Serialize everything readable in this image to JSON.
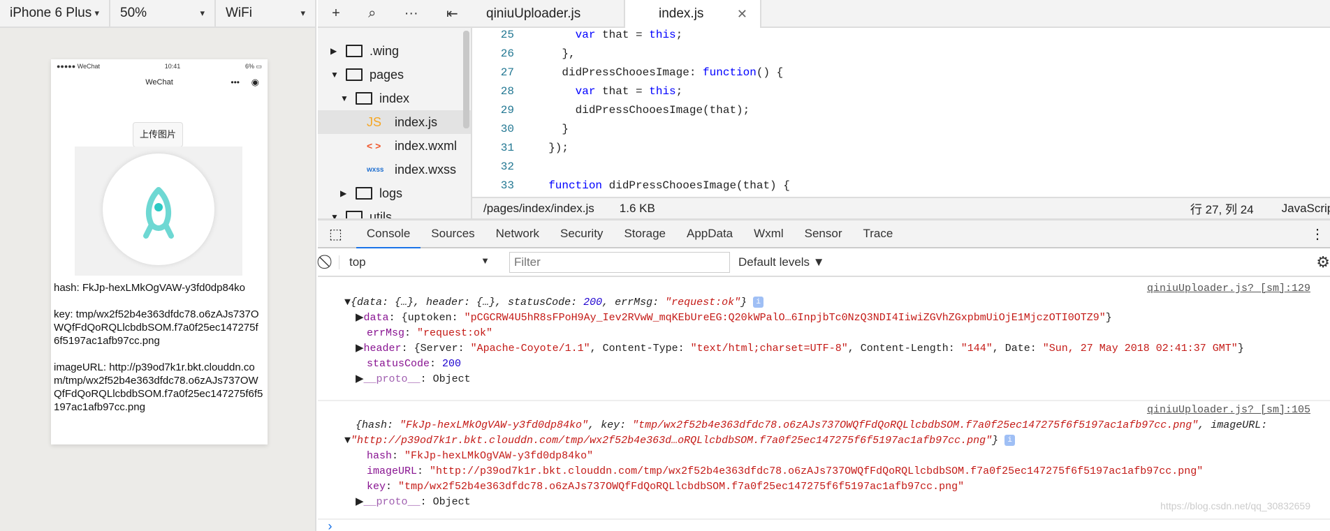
{
  "simulator": {
    "device": "iPhone 6 Plus",
    "zoom": "50%",
    "network": "WiFi"
  },
  "phone": {
    "signal": "●●●●● WeChat",
    "time": "10:41",
    "battery": "6%",
    "nav_title": "WeChat",
    "upload_button": "上传图片",
    "hash_text": "hash: FkJp-hexLMkOgVAW-y3fd0dp84ko",
    "key_text": "key: tmp/wx2f52b4e363dfdc78.o6zAJs737OWQfFdQoRQLlcbdbSOM.f7a0f25ec147275f6f5197ac1afb97cc.png",
    "url_text": "imageURL: http://p39od7k1r.bkt.clouddn.com/tmp/wx2f52b4e363dfdc78.o6zAJs737OWQfFdQoRQLlcbdbSOM.f7a0f25ec147275f6f5197ac1afb97cc.png"
  },
  "tree": [
    {
      "label": ".wing"
    },
    {
      "label": "pages"
    },
    {
      "label": "index"
    },
    {
      "label": "index.js",
      "badge": "JS"
    },
    {
      "label": "index.wxml",
      "badge": "< >"
    },
    {
      "label": "index.wxss",
      "badge": "wxss"
    },
    {
      "label": "logs"
    },
    {
      "label": "utils"
    }
  ],
  "editor": {
    "tabs": [
      "qiniuUploader.js",
      "index.js"
    ],
    "lines": [
      {
        "n": "25",
        "t": "      var that = this;"
      },
      {
        "n": "26",
        "t": "    },"
      },
      {
        "n": "27",
        "t": "    didPressChooesImage: function() {"
      },
      {
        "n": "28",
        "t": "      var that = this;"
      },
      {
        "n": "29",
        "t": "      didPressChooesImage(that);"
      },
      {
        "n": "30",
        "t": "    }"
      },
      {
        "n": "31",
        "t": "  });"
      },
      {
        "n": "32",
        "t": ""
      },
      {
        "n": "33",
        "t": "  function didPressChooesImage(that) {"
      }
    ],
    "path": "/pages/index/index.js",
    "size": "1.6 KB",
    "cursor": "行 27, 列 24",
    "language": "JavaScript"
  },
  "devtools": {
    "tabs": [
      "Console",
      "Sources",
      "Network",
      "Security",
      "Storage",
      "AppData",
      "Wxml",
      "Sensor",
      "Trace"
    ],
    "context": "top",
    "filter_placeholder": "Filter",
    "levels": "Default levels ▼"
  },
  "console": {
    "m1": {
      "src": "qiniuUploader.js? [sm]:129",
      "l1a": "{data: {…}, header: {…}, statusCode: ",
      "l1b": "200",
      "l1c": ", errMsg: ",
      "l1d": "\"request:ok\"",
      "l1e": "}",
      "data_k": "data",
      "data_v": ": {uptoken: ",
      "data_s": "\"pCGCRW4U5hR8sFPoH9Ay_Iev2RVwW_mqKEbUreEG:Q20kWPalO…6InpjbTc0NzQ3NDI4IiwiZGVhZGxpbmUiOjE1MjczOTI0OTZ9\"",
      "data_e": "}",
      "err_k": "errMsg",
      "err_v": "\"request:ok\"",
      "hdr_k": "header",
      "hdr_1": ": {Server: ",
      "hdr_2": "\"Apache-Coyote/1.1\"",
      "hdr_3": ", Content-Type: ",
      "hdr_4": "\"text/html;charset=UTF-8\"",
      "hdr_5": ", Content-Length: ",
      "hdr_6": "\"144\"",
      "hdr_7": ", Date: ",
      "hdr_8": "\"Sun, 27 May 2018 02:41:37 GMT\"",
      "hdr_9": "}",
      "sc_k": "statusCode",
      "sc_v": "200",
      "proto_k": "__proto__",
      "proto_v": ": Object"
    },
    "m2": {
      "src": "qiniuUploader.js? [sm]:105",
      "l1a": "{hash: ",
      "l1b": "\"FkJp-hexLMkOgVAW-y3fd0dp84ko\"",
      "l1c": ", key: ",
      "l1d": "\"tmp/wx2f52b4e363dfdc78.o6zAJs737OWQfFdQoRQLlcbdbSOM.f7a0f25ec147275f6f5197ac1afb97cc.png\"",
      "l1e": ", imageURL:",
      "l2a": "\"http://p39od7k1r.bkt.clouddn.com/tmp/wx2f52b4e363d…oRQLlcbdbSOM.f7a0f25ec147275f6f5197ac1afb97cc.png\"",
      "l2b": "}",
      "hash_k": "hash",
      "hash_v": "\"FkJp-hexLMkOgVAW-y3fd0dp84ko\"",
      "url_k": "imageURL",
      "url_v": "\"http://p39od7k1r.bkt.clouddn.com/tmp/wx2f52b4e363dfdc78.o6zAJs737OWQfFdQoRQLlcbdbSOM.f7a0f25ec147275f6f5197ac1afb97cc.png\"",
      "key_k": "key",
      "key_v": "\"tmp/wx2f52b4e363dfdc78.o6zAJs737OWQfFdQoRQLlcbdbSOM.f7a0f25ec147275f6f5197ac1afb97cc.png\"",
      "proto_k": "__proto__",
      "proto_v": ": Object"
    },
    "prompt": "›"
  },
  "watermark": "https://blog.csdn.net/qq_30832659",
  "colors": {
    "accent": "#1a73e8",
    "string": "#c41a16",
    "number": "#1c00cf",
    "property": "#881391",
    "logo": "#6ed8d3"
  }
}
